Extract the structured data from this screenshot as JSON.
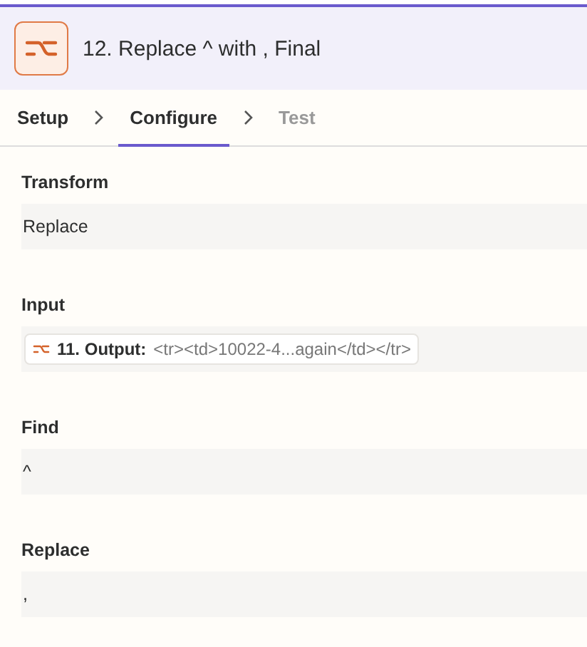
{
  "header": {
    "title": "12. Replace ^ with , Final"
  },
  "tabs": [
    {
      "label": "Setup",
      "selected": false,
      "disabled": false
    },
    {
      "label": "Configure",
      "selected": true,
      "disabled": false
    },
    {
      "label": "Test",
      "selected": false,
      "disabled": true
    }
  ],
  "fields": [
    {
      "label": "Transform",
      "kind": "text",
      "value": "Replace"
    },
    {
      "label": "Input",
      "kind": "mapped",
      "chip": {
        "step": "11. Output:",
        "value": "<tr><td>10022-4...again</td></tr>"
      }
    },
    {
      "label": "Find",
      "kind": "text",
      "value": "^"
    },
    {
      "label": "Replace",
      "kind": "text",
      "value": ","
    }
  ]
}
